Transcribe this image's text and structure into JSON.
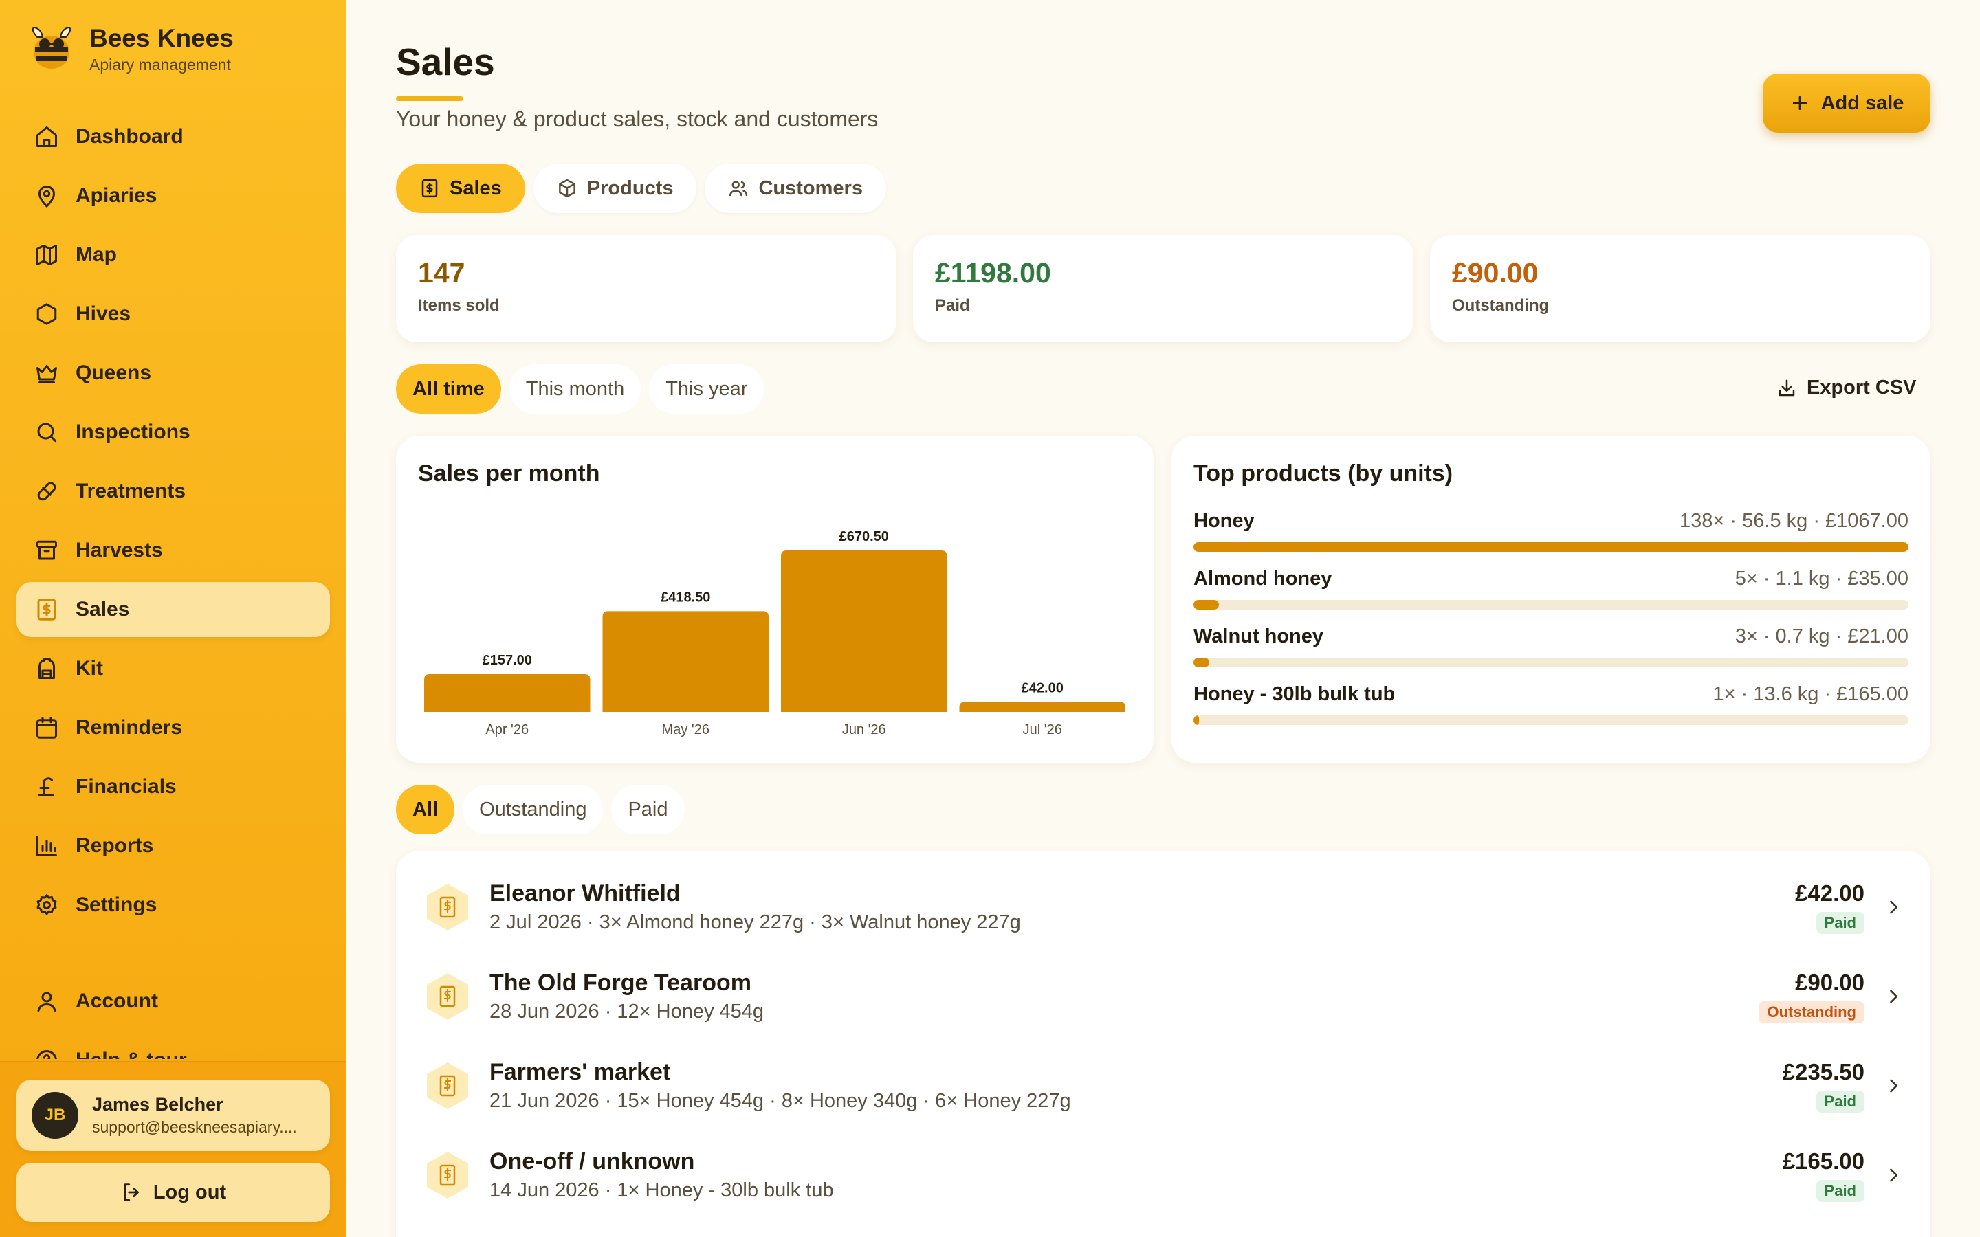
{
  "brand": {
    "name": "Bees Knees",
    "subtitle": "Apiary management"
  },
  "nav": {
    "items": [
      {
        "label": "Dashboard",
        "icon": "home-icon"
      },
      {
        "label": "Apiaries",
        "icon": "map-pin-icon"
      },
      {
        "label": "Map",
        "icon": "map-icon"
      },
      {
        "label": "Hives",
        "icon": "hexagon-icon"
      },
      {
        "label": "Queens",
        "icon": "crown-icon"
      },
      {
        "label": "Inspections",
        "icon": "search-icon"
      },
      {
        "label": "Treatments",
        "icon": "pill-icon"
      },
      {
        "label": "Harvests",
        "icon": "archive-icon"
      },
      {
        "label": "Sales",
        "icon": "receipt-icon",
        "active": true
      },
      {
        "label": "Kit",
        "icon": "backpack-icon"
      },
      {
        "label": "Reminders",
        "icon": "calendar-icon"
      },
      {
        "label": "Financials",
        "icon": "pound-icon"
      },
      {
        "label": "Reports",
        "icon": "bar-chart-icon"
      },
      {
        "label": "Settings",
        "icon": "gear-icon"
      }
    ],
    "account": "Account",
    "help": "Help & tour"
  },
  "user": {
    "initials": "JB",
    "name": "James Belcher",
    "email": "support@beesknees­apiary...."
  },
  "logout": "Log out",
  "header": {
    "title": "Sales",
    "subtitle": "Your honey & product sales, stock and customers",
    "add_button": "Add sale"
  },
  "tabs": [
    {
      "label": "Sales",
      "active": true
    },
    {
      "label": "Products"
    },
    {
      "label": "Customers"
    }
  ],
  "stats": [
    {
      "value": "147",
      "label": "Items sold",
      "color": "#8a5a00"
    },
    {
      "value": "£1198.00",
      "label": "Paid",
      "color": "#2f7a3c"
    },
    {
      "value": "£90.00",
      "label": "Outstanding",
      "color": "#c2600b"
    }
  ],
  "periods": [
    "All time",
    "This month",
    "This year"
  ],
  "export_label": "Export CSV",
  "chart": {
    "title": "Sales per month"
  },
  "chart_data": {
    "type": "bar",
    "categories": [
      "Apr '26",
      "May '26",
      "Jun '26",
      "Jul '26"
    ],
    "values": [
      157.0,
      418.5,
      670.5,
      42.0
    ],
    "labels": [
      "£157.00",
      "£418.50",
      "£670.50",
      "£42.00"
    ],
    "title": "Sales per month",
    "xlabel": "",
    "ylabel": "",
    "color": "#d98c00"
  },
  "top_products": {
    "title": "Top products (by units)",
    "items": [
      {
        "name": "Honey",
        "meta": "138× · 56.5 kg · £1067.00",
        "share": 1.0
      },
      {
        "name": "Almond honey",
        "meta": "5× · 1.1 kg · £35.00",
        "share": 0.036
      },
      {
        "name": "Walnut honey",
        "meta": "3× · 0.7 kg · £21.00",
        "share": 0.022
      },
      {
        "name": "Honey - 30lb bulk tub",
        "meta": "1× · 13.6 kg · £165.00",
        "share": 0.007
      }
    ]
  },
  "filters": [
    "All",
    "Outstanding",
    "Paid"
  ],
  "sales": [
    {
      "name": "Eleanor Whitfield",
      "desc": "2 Jul 2026 · 3× Almond honey 227g · 3× Walnut honey 227g",
      "amount": "£42.00",
      "status": "Paid"
    },
    {
      "name": "The Old Forge Tearoom",
      "desc": "28 Jun 2026 · 12× Honey 454g",
      "amount": "£90.00",
      "status": "Outstanding"
    },
    {
      "name": "Farmers' market",
      "desc": "21 Jun 2026 · 15× Honey 454g · 8× Honey 340g · 6× Honey 227g",
      "amount": "£235.50",
      "status": "Paid"
    },
    {
      "name": "One-off / unknown",
      "desc": "14 Jun 2026 · 1× Honey - 30lb bulk tub",
      "amount": "£165.00",
      "status": "Paid"
    }
  ]
}
